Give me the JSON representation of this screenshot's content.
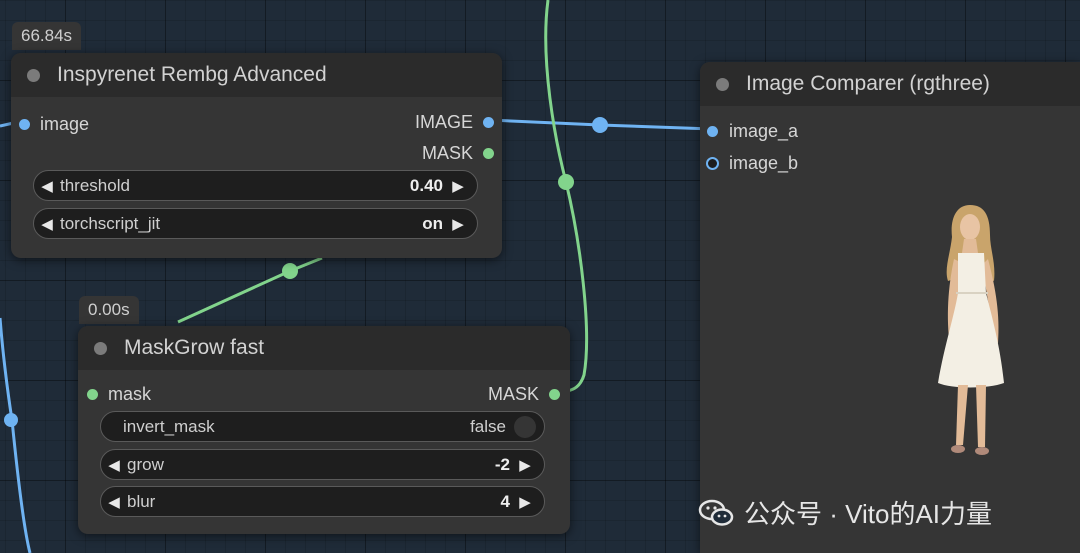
{
  "inspyrenet_node": {
    "timing": "66.84s",
    "title": "Inspyrenet Rembg Advanced",
    "input_label": "image",
    "outputs": [
      "IMAGE",
      "MASK"
    ],
    "widgets": [
      {
        "name": "threshold",
        "value": "0.40"
      },
      {
        "name": "torchscript_jit",
        "value": "on"
      }
    ]
  },
  "maskgrow_node": {
    "timing": "0.00s",
    "title": "MaskGrow fast",
    "input_label": "mask",
    "output_label": "MASK",
    "toggle": {
      "name": "invert_mask",
      "value": "false"
    },
    "widgets": [
      {
        "name": "grow",
        "value": "-2"
      },
      {
        "name": "blur",
        "value": "4"
      }
    ]
  },
  "comparer_node": {
    "title": "Image Comparer (rgthree)",
    "inputs": [
      "image_a",
      "image_b"
    ]
  },
  "colors": {
    "image_link": "#6fb3f2",
    "mask_link": "#82d48c"
  },
  "watermark": {
    "text": "公众号 · Vito的AI力量"
  }
}
